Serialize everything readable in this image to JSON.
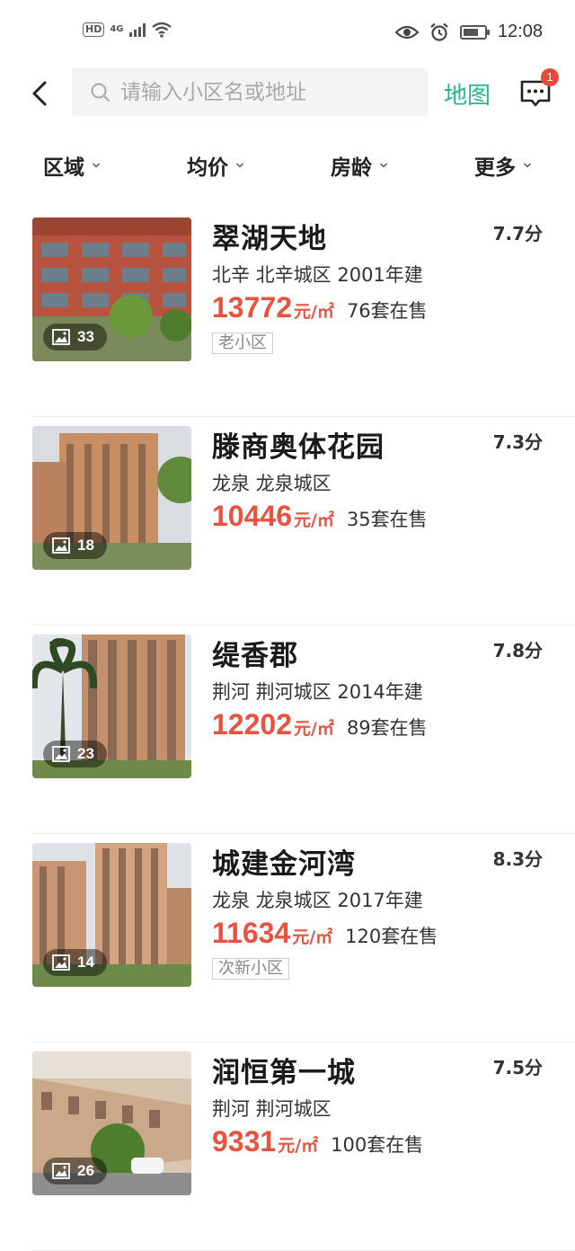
{
  "status_bar": {
    "hd": "HD",
    "network": "4G",
    "time": "12:08"
  },
  "header": {
    "search_placeholder": "请输入小区名或地址",
    "map_label": "地图",
    "message_badge": "1"
  },
  "filters": [
    {
      "label": "区域"
    },
    {
      "label": "均价"
    },
    {
      "label": "房龄"
    },
    {
      "label": "更多"
    }
  ],
  "listings": [
    {
      "name": "翠湖天地",
      "score": "7.7分",
      "location": "北辛  北辛城区  2001年建",
      "price": "13772",
      "unit": "元/㎡",
      "on_sale": "76套在售",
      "tag": "老小区",
      "photos": "33"
    },
    {
      "name": "滕商奥体花园",
      "score": "7.3分",
      "location": "龙泉  龙泉城区",
      "price": "10446",
      "unit": "元/㎡",
      "on_sale": "35套在售",
      "tag": "",
      "photos": "18"
    },
    {
      "name": "缇香郡",
      "score": "7.8分",
      "location": "荆河  荆河城区  2014年建",
      "price": "12202",
      "unit": "元/㎡",
      "on_sale": "89套在售",
      "tag": "",
      "photos": "23"
    },
    {
      "name": "城建金河湾",
      "score": "8.3分",
      "location": "龙泉  龙泉城区  2017年建",
      "price": "11634",
      "unit": "元/㎡",
      "on_sale": "120套在售",
      "tag": "次新小区",
      "photos": "14"
    },
    {
      "name": "润恒第一城",
      "score": "7.5分",
      "location": "荆河  荆河城区",
      "price": "9331",
      "unit": "元/㎡",
      "on_sale": "100套在售",
      "tag": "",
      "photos": "26"
    }
  ],
  "colors": {
    "accent_green": "#2bb58a",
    "price_red": "#e8533f",
    "badge_red": "#e8483a"
  }
}
